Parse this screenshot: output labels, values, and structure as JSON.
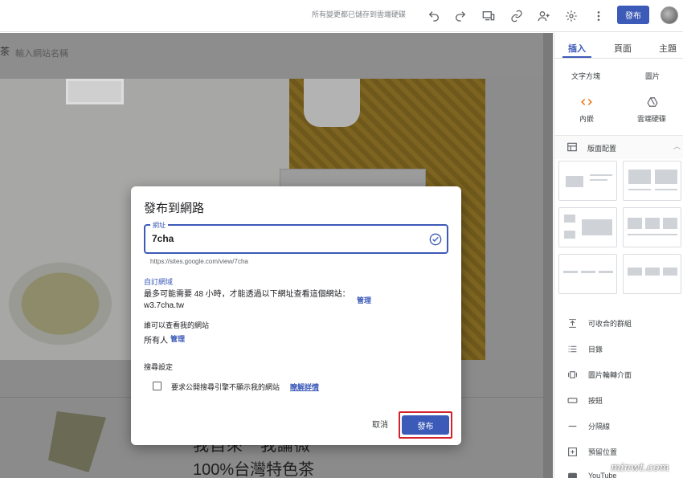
{
  "toolbar": {
    "save_status": "所有變更都已儲存到雲端硬碟",
    "publish_label": "發布",
    "icons": [
      "undo-icon",
      "redo-icon",
      "preview-icon",
      "link-icon",
      "add-person-icon",
      "gear-icon",
      "more-icon"
    ]
  },
  "site": {
    "logo_char": "茶",
    "name_placeholder": "輸入網站名稱",
    "lower_title_1": "我自來一我論微",
    "lower_title_2": "100%台灣特色茶"
  },
  "panel": {
    "tabs": [
      {
        "label": "插入",
        "active": true
      },
      {
        "label": "頁面",
        "active": false
      },
      {
        "label": "主題",
        "active": false
      }
    ],
    "quick_items": [
      {
        "label": "文字方塊"
      },
      {
        "label": "圖片"
      },
      {
        "label": "內嵌",
        "icon": "code-icon"
      },
      {
        "label": "雲端硬碟",
        "icon": "drive-icon"
      }
    ],
    "layout_header": "版面配置",
    "list": [
      {
        "label": "可收合的群組",
        "icon": "collapse-icon"
      },
      {
        "label": "目錄",
        "icon": "toc-icon"
      },
      {
        "label": "圖片輪轉介面",
        "icon": "carousel-icon"
      },
      {
        "label": "按鈕",
        "icon": "button-icon"
      },
      {
        "label": "分隔線",
        "icon": "divider-icon"
      },
      {
        "label": "預留位置",
        "icon": "placeholder-icon"
      },
      {
        "label": "YouTube",
        "icon": "youtube-icon"
      }
    ]
  },
  "dialog": {
    "title": "發布到網路",
    "url_label": "網址",
    "url_value": "7cha",
    "url_hint": "https://sites.google.com/view/7cha",
    "custom_domain_label": "自訂網域",
    "domain_text": "最多可能需要 48 小時，才能透過以下網址查看這個網站： w3.7cha.tw",
    "manage_label": "管理",
    "who_can_view_label": "誰可以查看我的網站",
    "who_can_view_value": "所有人",
    "search_settings_label": "搜尋設定",
    "checkbox_label": "要求公開搜尋引擎不顯示我的網站",
    "learn_more": "瞭解詳情",
    "cancel": "取消",
    "publish": "發布"
  },
  "watermark": "minwt.com",
  "colors": {
    "accent": "#3c5ab8",
    "highlight": "#d3232a"
  }
}
